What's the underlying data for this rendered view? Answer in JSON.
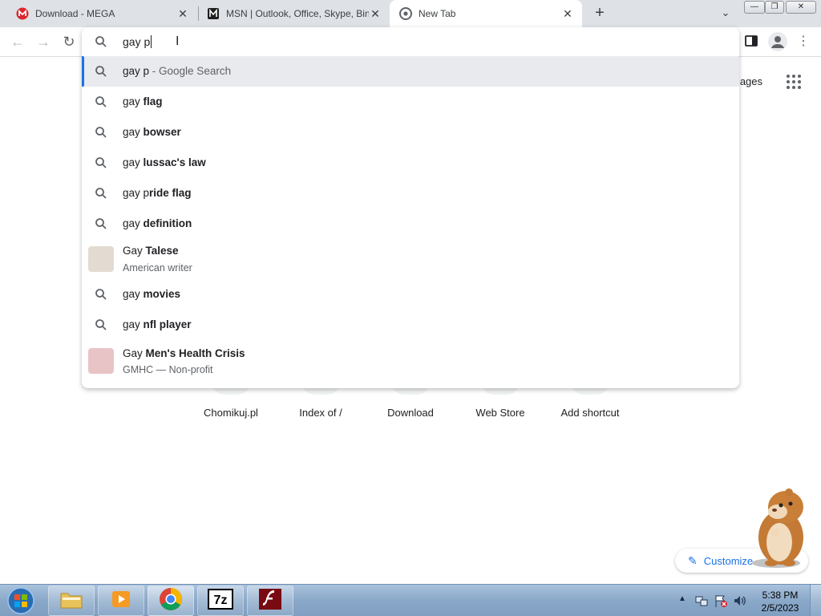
{
  "browser": {
    "tabs": [
      {
        "title": "Download - MEGA",
        "icon": "mega-icon",
        "active": false
      },
      {
        "title": "MSN | Outlook, Office, Skype, Bin",
        "icon": "msn-icon",
        "active": false
      },
      {
        "title": "New Tab",
        "icon": "chrome-icon",
        "active": true
      }
    ],
    "new_tab_symbol": "+",
    "tab_search_symbol": "⌄",
    "window_controls": {
      "minimize": "—",
      "maximize": "❐",
      "close": "✕"
    }
  },
  "toolbar": {
    "back_symbol": "←",
    "forward_symbol": "→",
    "reload_symbol": "↻",
    "menu_symbol": "⋮"
  },
  "omnibox": {
    "input_value": "gay p",
    "suggestions": [
      {
        "prefix": "gay p",
        "bold": "",
        "suffix": " - Google Search",
        "type": "search",
        "selected": true
      },
      {
        "prefix": "gay ",
        "bold": "flag",
        "suffix": "",
        "type": "search"
      },
      {
        "prefix": "gay ",
        "bold": "bowser",
        "suffix": "",
        "type": "search"
      },
      {
        "prefix": "gay ",
        "bold": "lussac's law",
        "suffix": "",
        "type": "search"
      },
      {
        "prefix": "gay p",
        "bold": "ride flag",
        "suffix": "",
        "type": "search"
      },
      {
        "prefix": "gay ",
        "bold": "definition",
        "suffix": "",
        "type": "search"
      },
      {
        "prefix": "Gay ",
        "bold": "Talese",
        "subtitle": "American writer",
        "type": "entity",
        "thumb_color": "#e3dbd1"
      },
      {
        "prefix": "gay ",
        "bold": "movies",
        "suffix": "",
        "type": "search"
      },
      {
        "prefix": "gay ",
        "bold": "nfl player",
        "suffix": "",
        "type": "search"
      },
      {
        "prefix": "Gay ",
        "bold": "Men's Health Crisis",
        "subtitle": "GMHC — Non-profit",
        "type": "entity",
        "thumb_color": "#e9c4c7"
      }
    ]
  },
  "ntp": {
    "images_link": "mages",
    "shortcuts": [
      "Chomikuj.pl",
      "Index of /",
      "Download",
      "Web Store",
      "Add shortcut"
    ],
    "customize_label": "Customize"
  },
  "taskbar": {
    "items": [
      "file-explorer",
      "media-player",
      "chrome",
      "7zip",
      "flash"
    ],
    "clock_time": "5:38 PM",
    "clock_date": "2/5/2023"
  },
  "colors": {
    "accent": "#1a73e8",
    "tabstrip": "#dee1e6",
    "selected_row": "#e8eaed"
  }
}
